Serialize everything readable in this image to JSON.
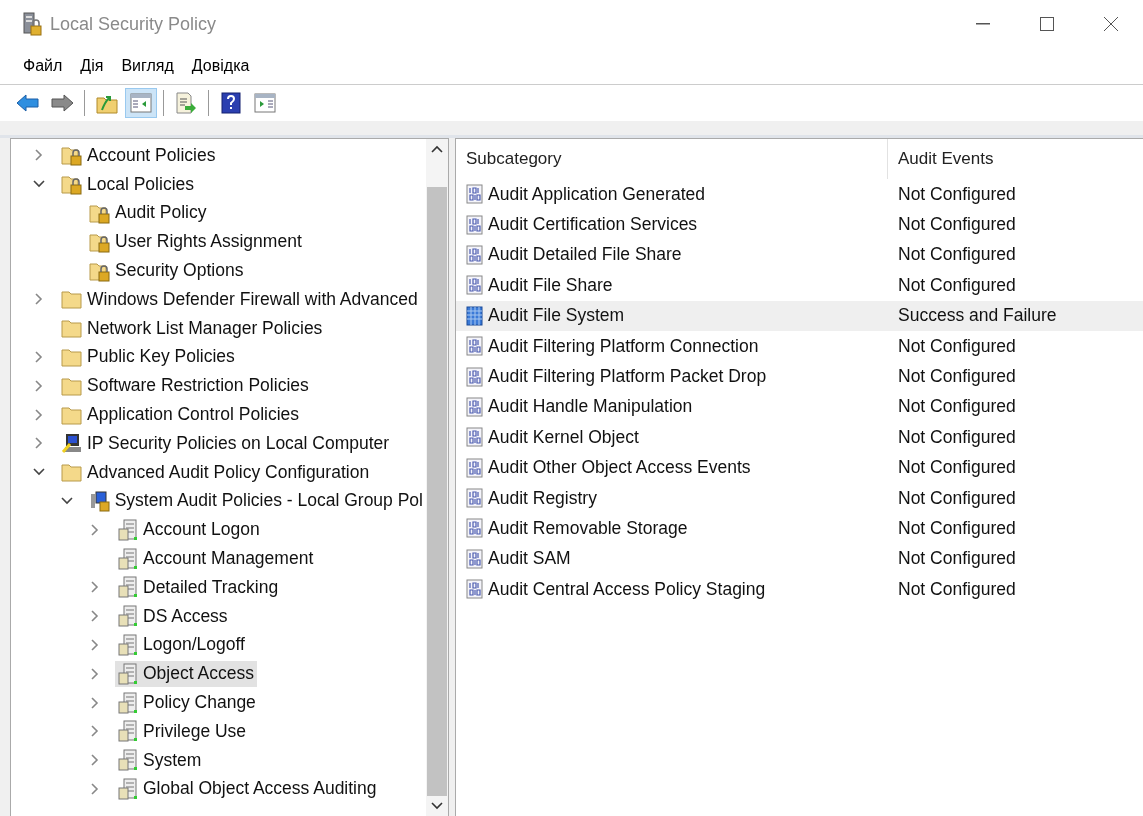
{
  "window": {
    "title": "Local Security Policy"
  },
  "menu": [
    {
      "label": "Файл"
    },
    {
      "label": "Дія"
    },
    {
      "label": "Вигляд"
    },
    {
      "label": "Довідка"
    }
  ],
  "toolbar": [
    {
      "kind": "back",
      "pressed": false
    },
    {
      "kind": "forward",
      "pressed": false
    },
    {
      "kind": "separator"
    },
    {
      "kind": "up",
      "pressed": false
    },
    {
      "kind": "tree",
      "pressed": true
    },
    {
      "kind": "separator"
    },
    {
      "kind": "export",
      "pressed": false
    },
    {
      "kind": "separator"
    },
    {
      "kind": "help",
      "pressed": false
    },
    {
      "kind": "action",
      "pressed": false
    }
  ],
  "tree": [
    {
      "label": "Account Policies",
      "kind": "lock-folder",
      "expanded": false,
      "selected": false
    },
    {
      "label": "Local Policies",
      "kind": "lock-folder",
      "expanded": true,
      "selected": false,
      "children": [
        {
          "label": "Audit Policy",
          "kind": "lock-folder",
          "selected": false
        },
        {
          "label": "User Rights Assignment",
          "kind": "lock-folder",
          "selected": false
        },
        {
          "label": "Security Options",
          "kind": "lock-folder",
          "selected": false
        }
      ]
    },
    {
      "label": "Windows Defender Firewall with Advanced",
      "kind": "folder",
      "expanded": false,
      "selected": false
    },
    {
      "label": "Network List Manager Policies",
      "kind": "folder",
      "selected": false
    },
    {
      "label": "Public Key Policies",
      "kind": "folder",
      "expanded": false,
      "selected": false
    },
    {
      "label": "Software Restriction Policies",
      "kind": "folder",
      "expanded": false,
      "selected": false
    },
    {
      "label": "Application Control Policies",
      "kind": "folder",
      "expanded": false,
      "selected": false
    },
    {
      "label": "IP Security Policies on Local Computer",
      "kind": "ip",
      "expanded": false,
      "selected": false
    },
    {
      "label": "Advanced Audit Policy Configuration",
      "kind": "folder",
      "expanded": true,
      "selected": false,
      "children": [
        {
          "label": "System Audit Policies - Local Group Pol",
          "kind": "audit-root",
          "expanded": true,
          "selected": false,
          "children": [
            {
              "label": "Account Logon",
              "kind": "policy",
              "expanded": false,
              "selected": false
            },
            {
              "label": "Account Management",
              "kind": "policy",
              "selected": false
            },
            {
              "label": "Detailed Tracking",
              "kind": "policy",
              "expanded": false,
              "selected": false
            },
            {
              "label": "DS Access",
              "kind": "policy",
              "expanded": false,
              "selected": false
            },
            {
              "label": "Logon/Logoff",
              "kind": "policy",
              "expanded": false,
              "selected": false
            },
            {
              "label": "Object Access",
              "kind": "policy",
              "expanded": false,
              "selected": true
            },
            {
              "label": "Policy Change",
              "kind": "policy",
              "expanded": false,
              "selected": false
            },
            {
              "label": "Privilege Use",
              "kind": "policy",
              "expanded": false,
              "selected": false
            },
            {
              "label": "System",
              "kind": "policy",
              "expanded": false,
              "selected": false
            },
            {
              "label": "Global Object Access Auditing",
              "kind": "policy",
              "expanded": false,
              "selected": false
            }
          ]
        }
      ]
    }
  ],
  "table": {
    "columns": [
      "Subcategory",
      "Audit Events"
    ],
    "rows": [
      {
        "name": "Audit Application Generated",
        "value": "Not Configured",
        "kind": "binary",
        "selected": false
      },
      {
        "name": "Audit Certification Services",
        "value": "Not Configured",
        "kind": "binary",
        "selected": false
      },
      {
        "name": "Audit Detailed File Share",
        "value": "Not Configured",
        "kind": "binary",
        "selected": false
      },
      {
        "name": "Audit File Share",
        "value": "Not Configured",
        "kind": "binary",
        "selected": false
      },
      {
        "name": "Audit File System",
        "value": "Success and Failure",
        "kind": "configured",
        "selected": true
      },
      {
        "name": "Audit Filtering Platform Connection",
        "value": "Not Configured",
        "kind": "binary",
        "selected": false
      },
      {
        "name": "Audit Filtering Platform Packet Drop",
        "value": "Not Configured",
        "kind": "binary",
        "selected": false
      },
      {
        "name": "Audit Handle Manipulation",
        "value": "Not Configured",
        "kind": "binary",
        "selected": false
      },
      {
        "name": "Audit Kernel Object",
        "value": "Not Configured",
        "kind": "binary",
        "selected": false
      },
      {
        "name": "Audit Other Object Access Events",
        "value": "Not Configured",
        "kind": "binary",
        "selected": false
      },
      {
        "name": "Audit Registry",
        "value": "Not Configured",
        "kind": "binary",
        "selected": false
      },
      {
        "name": "Audit Removable Storage",
        "value": "Not Configured",
        "kind": "binary",
        "selected": false
      },
      {
        "name": "Audit SAM",
        "value": "Not Configured",
        "kind": "binary",
        "selected": false
      },
      {
        "name": "Audit Central Access Policy Staging",
        "value": "Not Configured",
        "kind": "binary",
        "selected": false
      }
    ]
  }
}
